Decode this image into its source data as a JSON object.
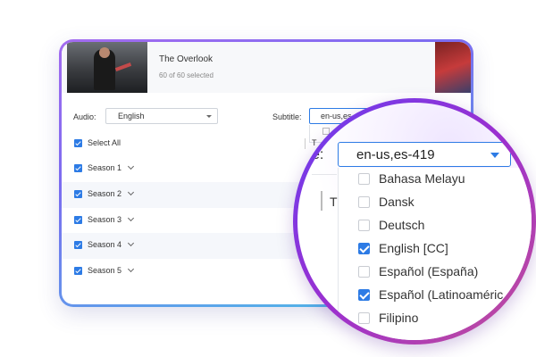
{
  "header": {
    "title": "The Overlook",
    "selected": "60 of 60 selected"
  },
  "audio": {
    "label": "Audio:",
    "value": "English"
  },
  "subtitle": {
    "label": "Subtitle:",
    "value": "en-us,es",
    "zoom_label": "e:",
    "zoom_value": "en-us,es-419",
    "zoom_t": "T"
  },
  "select_all": "Select All",
  "seasons": [
    {
      "label": "Season 1"
    },
    {
      "label": "Season 2"
    },
    {
      "label": "Season 3"
    },
    {
      "label": "Season 4"
    },
    {
      "label": "Season 5"
    }
  ],
  "row_t": "T",
  "languages": [
    {
      "label": "Bahasa Melayu",
      "checked": false
    },
    {
      "label": "Dansk",
      "checked": false
    },
    {
      "label": "Deutsch",
      "checked": false
    },
    {
      "label": "English [CC]",
      "checked": true
    },
    {
      "label": "Español (España)",
      "checked": false
    },
    {
      "label": "Español (Latinoaméric",
      "checked": true
    },
    {
      "label": "Filipino",
      "checked": false
    }
  ],
  "colors": {
    "accent": "#2d7be5",
    "frame_start": "#a46bf0",
    "frame_end": "#49c5e6",
    "lens_ring_start": "#6a3ef0",
    "lens_ring_end": "#c44f96"
  }
}
